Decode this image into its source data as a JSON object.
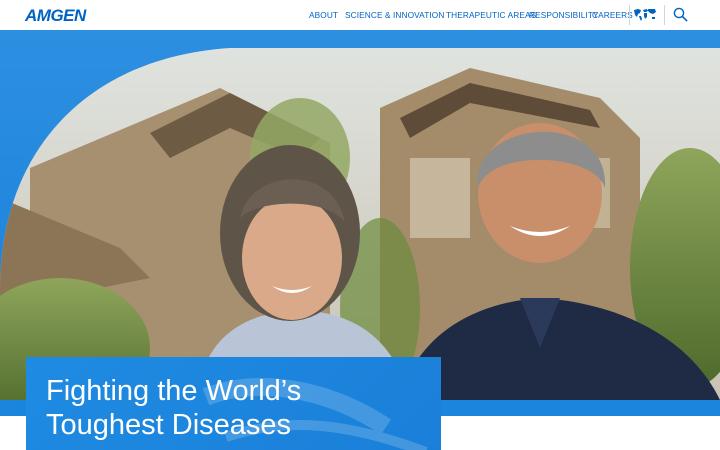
{
  "header": {
    "logo_text": "AMGEN",
    "nav": [
      {
        "label": "ABOUT"
      },
      {
        "label": "SCIENCE & INNOVATION"
      },
      {
        "label": "THERAPEUTIC AREAS"
      },
      {
        "label": "RESPONSIBILITY"
      },
      {
        "label": "CAREERS"
      }
    ],
    "icons": [
      "world-map-icon",
      "search-icon"
    ]
  },
  "hero": {
    "headline_line1": "Fighting the World’s",
    "headline_line2": "Toughest Diseases",
    "image_description_icon": "photo-of-smiling-couple"
  },
  "colors": {
    "brand_blue": "#0063c3",
    "hero_blue": "#1f86dd",
    "text_white": "#ffffff"
  }
}
